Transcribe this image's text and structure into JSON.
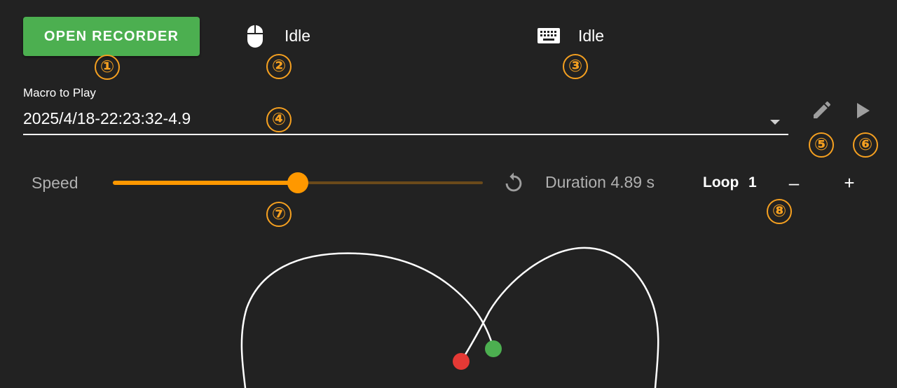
{
  "header": {
    "open_recorder_label": "OPEN RECORDER",
    "mouse_status": "Idle",
    "keyboard_status": "Idle"
  },
  "macro": {
    "label": "Macro to Play",
    "selected": "2025/4/18-22:23:32-4.9"
  },
  "controls": {
    "speed_label": "Speed",
    "speed_level": 0.5,
    "duration_text": "Duration 4.89 s",
    "loop_label": "Loop",
    "loop_value": "1",
    "decrement_label": "–",
    "increment_label": "+"
  },
  "badges": {
    "b1": "①",
    "b2": "②",
    "b3": "③",
    "b4": "④",
    "b5": "⑤",
    "b6": "⑥",
    "b7": "⑦",
    "b8": "⑧"
  },
  "colors": {
    "background": "#222222",
    "accent_green": "#4caf50",
    "accent_orange": "#ff9800",
    "badge_orange": "#f5a020",
    "path_start": "#4caf50",
    "path_end": "#e53935"
  },
  "icons": {
    "mouse": "mouse-icon",
    "keyboard": "keyboard-icon",
    "edit": "pencil-icon",
    "play": "play-icon",
    "reset": "refresh-icon",
    "dropdown": "caret-down-icon"
  }
}
